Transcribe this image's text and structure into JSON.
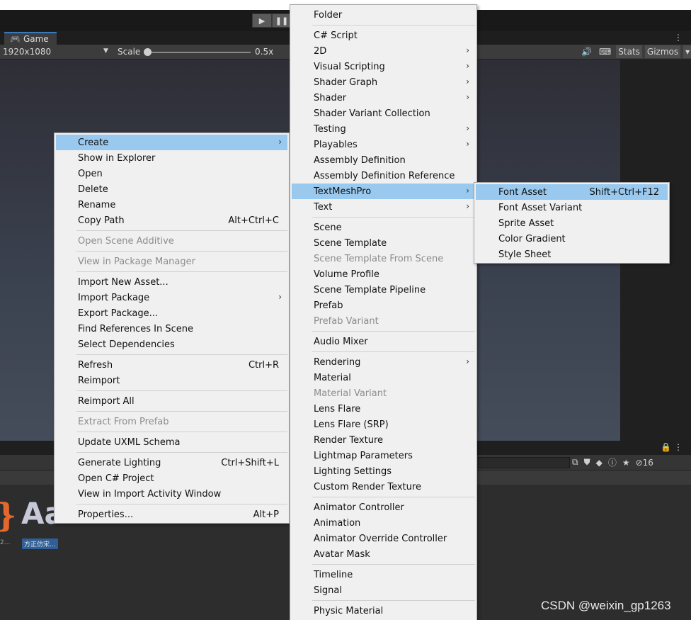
{
  "toolbar": {
    "play_icon": "play-icon",
    "pause_icon": "pause-icon"
  },
  "game_view": {
    "tab_label": "Game",
    "tab_icon": "gamepad-icon",
    "resolution": "1920x1080",
    "scale_label": "Scale",
    "scale_value": "0.5x",
    "stats_label": "Stats",
    "gizmos_label": "Gizmos"
  },
  "project": {
    "hidden_count": "16",
    "asset_label": "方正仿宋...",
    "asset_label_left": "2...",
    "asset_preview_text": "Aa"
  },
  "watermark": "CSDN @weixin_gp1263",
  "menu_asset": {
    "items": [
      {
        "label": "Create",
        "arrow": "›",
        "highlight": true
      },
      {
        "label": "Show in Explorer"
      },
      {
        "label": "Open"
      },
      {
        "label": "Delete"
      },
      {
        "label": "Rename"
      },
      {
        "label": "Copy Path",
        "shortcut": "Alt+Ctrl+C"
      },
      {
        "label": "Open Scene Additive",
        "disabled": true
      },
      {
        "label": "View in Package Manager",
        "disabled": true
      },
      {
        "label": "Import New Asset..."
      },
      {
        "label": "Import Package",
        "arrow": "›"
      },
      {
        "label": "Export Package..."
      },
      {
        "label": "Find References In Scene"
      },
      {
        "label": "Select Dependencies"
      },
      {
        "label": "Refresh",
        "shortcut": "Ctrl+R"
      },
      {
        "label": "Reimport"
      },
      {
        "label": "Reimport All"
      },
      {
        "label": "Extract From Prefab",
        "disabled": true
      },
      {
        "label": "Update UXML Schema"
      },
      {
        "label": "Generate Lighting",
        "shortcut": "Ctrl+Shift+L"
      },
      {
        "label": "Open C# Project"
      },
      {
        "label": "View in Import Activity Window"
      },
      {
        "label": "Properties...",
        "shortcut": "Alt+P"
      }
    ]
  },
  "menu_create": {
    "items": [
      {
        "label": "Folder"
      },
      {
        "label": "C# Script"
      },
      {
        "label": "2D",
        "arrow": "›"
      },
      {
        "label": "Visual Scripting",
        "arrow": "›"
      },
      {
        "label": "Shader Graph",
        "arrow": "›"
      },
      {
        "label": "Shader",
        "arrow": "›"
      },
      {
        "label": "Shader Variant Collection"
      },
      {
        "label": "Testing",
        "arrow": "›"
      },
      {
        "label": "Playables",
        "arrow": "›"
      },
      {
        "label": "Assembly Definition"
      },
      {
        "label": "Assembly Definition Reference"
      },
      {
        "label": "TextMeshPro",
        "arrow": "›",
        "highlight": true
      },
      {
        "label": "Text",
        "arrow": "›"
      },
      {
        "label": "Scene"
      },
      {
        "label": "Scene Template"
      },
      {
        "label": "Scene Template From Scene",
        "disabled": true
      },
      {
        "label": "Volume Profile"
      },
      {
        "label": "Scene Template Pipeline"
      },
      {
        "label": "Prefab"
      },
      {
        "label": "Prefab Variant",
        "disabled": true
      },
      {
        "label": "Audio Mixer"
      },
      {
        "label": "Rendering",
        "arrow": "›"
      },
      {
        "label": "Material"
      },
      {
        "label": "Material Variant",
        "disabled": true
      },
      {
        "label": "Lens Flare"
      },
      {
        "label": "Lens Flare (SRP)"
      },
      {
        "label": "Render Texture"
      },
      {
        "label": "Lightmap Parameters"
      },
      {
        "label": "Lighting Settings"
      },
      {
        "label": "Custom Render Texture"
      },
      {
        "label": "Animator Controller"
      },
      {
        "label": "Animation"
      },
      {
        "label": "Animator Override Controller"
      },
      {
        "label": "Avatar Mask"
      },
      {
        "label": "Timeline"
      },
      {
        "label": "Signal"
      },
      {
        "label": "Physic Material"
      }
    ]
  },
  "menu_textmeshpro": {
    "items": [
      {
        "label": "Font Asset",
        "shortcut": "Shift+Ctrl+F12",
        "highlight": true
      },
      {
        "label": "Font Asset Variant"
      },
      {
        "label": "Sprite Asset"
      },
      {
        "label": "Color Gradient"
      },
      {
        "label": "Style Sheet"
      }
    ]
  }
}
